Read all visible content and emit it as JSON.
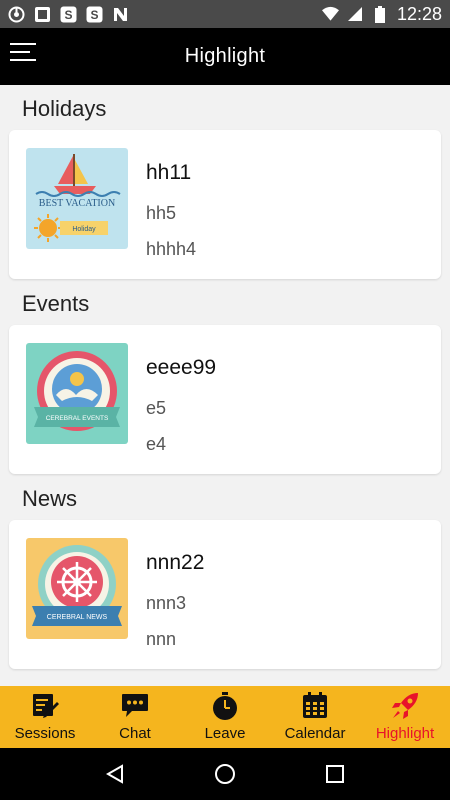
{
  "status_bar": {
    "time": "12:28",
    "icons": [
      "sync-icon",
      "screenshot-icon",
      "s-app-icon",
      "s-app-icon",
      "n-app-icon",
      "wifi-icon",
      "signal-icon",
      "battery-icon"
    ]
  },
  "app_bar": {
    "title": "Highlight",
    "menu_icon": "hamburger-icon"
  },
  "sections": [
    {
      "title": "Holidays",
      "card": {
        "title": "hh11",
        "line1": "hh5",
        "line2": "hhhh4",
        "image_text": "BEST VACATION",
        "image_sub": "Holiday"
      }
    },
    {
      "title": "Events",
      "card": {
        "title": "eeee99",
        "line1": "e5",
        "line2": "e4",
        "image_text": "CEREBRAL EVENTS"
      }
    },
    {
      "title": "News",
      "card": {
        "title": "nnn22",
        "line1": "nnn3",
        "line2": "nnn",
        "image_text": "CEREBRAL NEWS"
      }
    }
  ],
  "bottom_nav": {
    "items": [
      {
        "label": "Sessions",
        "icon": "sessions-icon"
      },
      {
        "label": "Chat",
        "icon": "chat-icon"
      },
      {
        "label": "Leave",
        "icon": "stopwatch-icon"
      },
      {
        "label": "Calendar",
        "icon": "calendar-icon"
      },
      {
        "label": "Highlight",
        "icon": "rocket-icon"
      }
    ],
    "active": "Highlight",
    "background": "#f5b51e",
    "active_color": "#e8132a"
  },
  "system_nav": {
    "icons": [
      "back-icon",
      "home-icon",
      "recents-icon"
    ]
  }
}
